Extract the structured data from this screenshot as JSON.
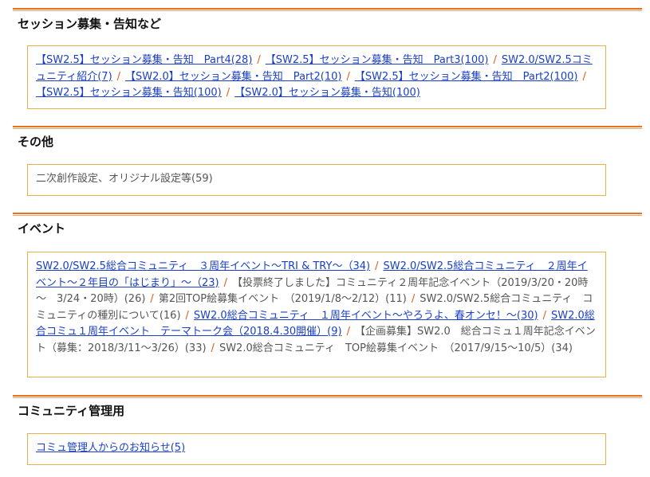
{
  "sections": [
    {
      "title": "セッション募集・告知など",
      "items": [
        {
          "label": "【SW2.5】セッション募集・告知　Part4(28)",
          "link": true
        },
        {
          "label": "【SW2.5】セッション募集・告知　Part3(100)",
          "link": true
        },
        {
          "label": "SW2.0/SW2.5コミュニティ紹介(7)",
          "link": true
        },
        {
          "label": "【SW2.0】セッション募集・告知　Part2(10)",
          "link": true
        },
        {
          "label": "【SW2.5】セッション募集・告知　Part2(100)",
          "link": true
        },
        {
          "label": "【SW2.5】セッション募集・告知(100)",
          "link": true
        },
        {
          "label": "【SW2.0】セッション募集・告知(100)",
          "link": true
        }
      ]
    },
    {
      "title": "その他",
      "items": [
        {
          "label": "二次創作設定、オリジナル設定等(59)",
          "link": false
        }
      ]
    },
    {
      "title": "イベント",
      "items": [
        {
          "label": "SW2.0/SW2.5総合コミュニティ　３周年イベント～TRI & TRY～（34)",
          "link": true
        },
        {
          "label": "SW2.0/SW2.5総合コミュニティ　２周年イベント～２年目の「はじまり」～（23)",
          "link": true
        },
        {
          "label": "【投票終了しました】コミュニティ２周年記念イベント（2019/3/20・20時～　3/24・20時）(26)",
          "link": false
        },
        {
          "label": "第2回TOP絵募集イベント　（2019/1/8～2/12）(11)",
          "link": false
        },
        {
          "label": "SW2.0/SW2.5総合コミュニティ　コミュニティの種別について(16)",
          "link": false
        },
        {
          "label": "SW2.0総合コミュニティ　１周年イベント～やろうよ、春オンセ！～(30)",
          "link": true
        },
        {
          "label": "SW2.0総合コミュ１周年イベント　テーマトーク会（2018.4.30開催）(9)",
          "link": true
        },
        {
          "label": "【企画募集】SW2.0　総合コミュ１周年記念イベント（募集：2018/3/11～3/26）(33)",
          "link": false
        },
        {
          "label": "SW2.0総合コミュニティ　TOP絵募集イベント　（2017/9/15～10/5）(34)",
          "link": false
        }
      ]
    },
    {
      "title": "コミュニティ管理用",
      "items": [
        {
          "label": "コミュ管理人からのお知らせ(5)",
          "link": true
        }
      ]
    }
  ],
  "separator": "/"
}
